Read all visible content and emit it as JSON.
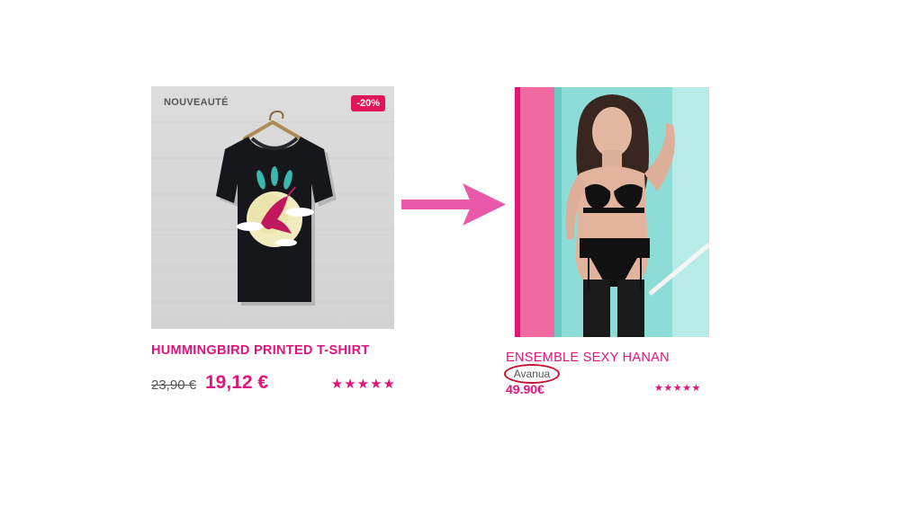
{
  "product_left": {
    "badge_new": "NOUVEAUTÉ",
    "badge_discount": "-20%",
    "title": "HUMMINGBIRD PRINTED T-SHIRT",
    "old_price": "23,90 €",
    "new_price": "19,12 €",
    "rating_stars": "★★★★★",
    "image_icon": "tshirt-image-icon"
  },
  "product_right": {
    "title": "ENSEMBLE SEXY HANAN",
    "brand": "Avanua",
    "price": "49.90€",
    "rating_stars": "★★★★★",
    "image_icon": "lingerie-photo-icon"
  },
  "arrow_icon": "arrow-right-icon",
  "colors": {
    "accent": "#e0147a",
    "discount_badge": "#e0145a",
    "brand_circle": "#c8102e",
    "arrow": "#e85aa8"
  }
}
